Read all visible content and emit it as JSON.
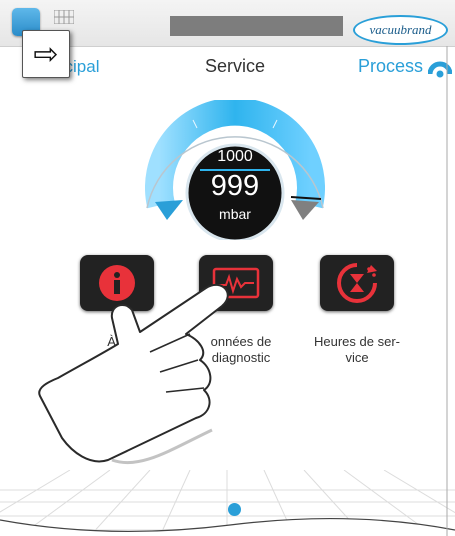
{
  "topbar": {
    "brand_text": "vacuubrand"
  },
  "nav": {
    "back_label": "Menu principal",
    "back_visible_fragment": "u principal",
    "title": "Service",
    "process_label": "Process"
  },
  "gauge": {
    "setpoint": "1000",
    "value": "999",
    "unit": "mbar"
  },
  "tiles": [
    {
      "label_line1": "À propos",
      "label_visible": "À p",
      "icon": "info-icon"
    },
    {
      "label_line1": "Données de",
      "label_line2": "diagnostic",
      "label_visible1": "onnées de",
      "label_visible2": "diagnostic",
      "icon": "diagnostic-icon"
    },
    {
      "label_line1": "Heures de ser-",
      "label_line2": "vice",
      "icon": "hourglass-timer-icon"
    }
  ],
  "colors": {
    "accent": "#2a9fd8",
    "tile_bg": "#222222",
    "icon_red": "#e8323a"
  }
}
